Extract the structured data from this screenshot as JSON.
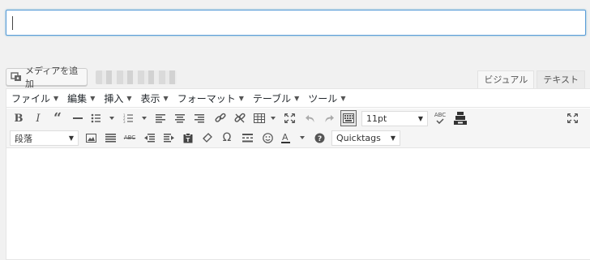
{
  "title_input": {
    "value": "",
    "placeholder": ""
  },
  "media": {
    "add_media_label": "メディアを追加"
  },
  "editor_tabs": [
    {
      "label": "ビジュアル",
      "active": false
    },
    {
      "label": "テキスト",
      "active": true
    }
  ],
  "menubar": {
    "items": [
      {
        "label": "ファイル"
      },
      {
        "label": "編集"
      },
      {
        "label": "挿入"
      },
      {
        "label": "表示"
      },
      {
        "label": "フォーマット"
      },
      {
        "label": "テーブル"
      },
      {
        "label": "ツール"
      }
    ]
  },
  "toolbar": {
    "font_size": "11pt",
    "paragraph_format": "段落",
    "quicktags": "Quicktags",
    "spellcheck_label": "ABC"
  },
  "icons": [
    "bold-icon",
    "italic-icon",
    "blockquote-icon",
    "horizontal-rule-icon",
    "bullet-list-icon",
    "numbered-list-icon",
    "align-left-icon",
    "align-center-icon",
    "align-right-icon",
    "link-icon",
    "unlink-icon",
    "table-icon",
    "fullscreen-icon",
    "undo-icon",
    "redo-icon",
    "keyboard-toggle-icon",
    "spellcheck-icon",
    "toolbar-toggle-icon",
    "image-icon",
    "justify-icon",
    "strikethrough-icon",
    "outdent-icon",
    "indent-icon",
    "paste-text-icon",
    "clear-format-icon",
    "special-char-icon",
    "read-more-icon",
    "emoji-icon",
    "text-color-icon",
    "help-icon"
  ]
}
